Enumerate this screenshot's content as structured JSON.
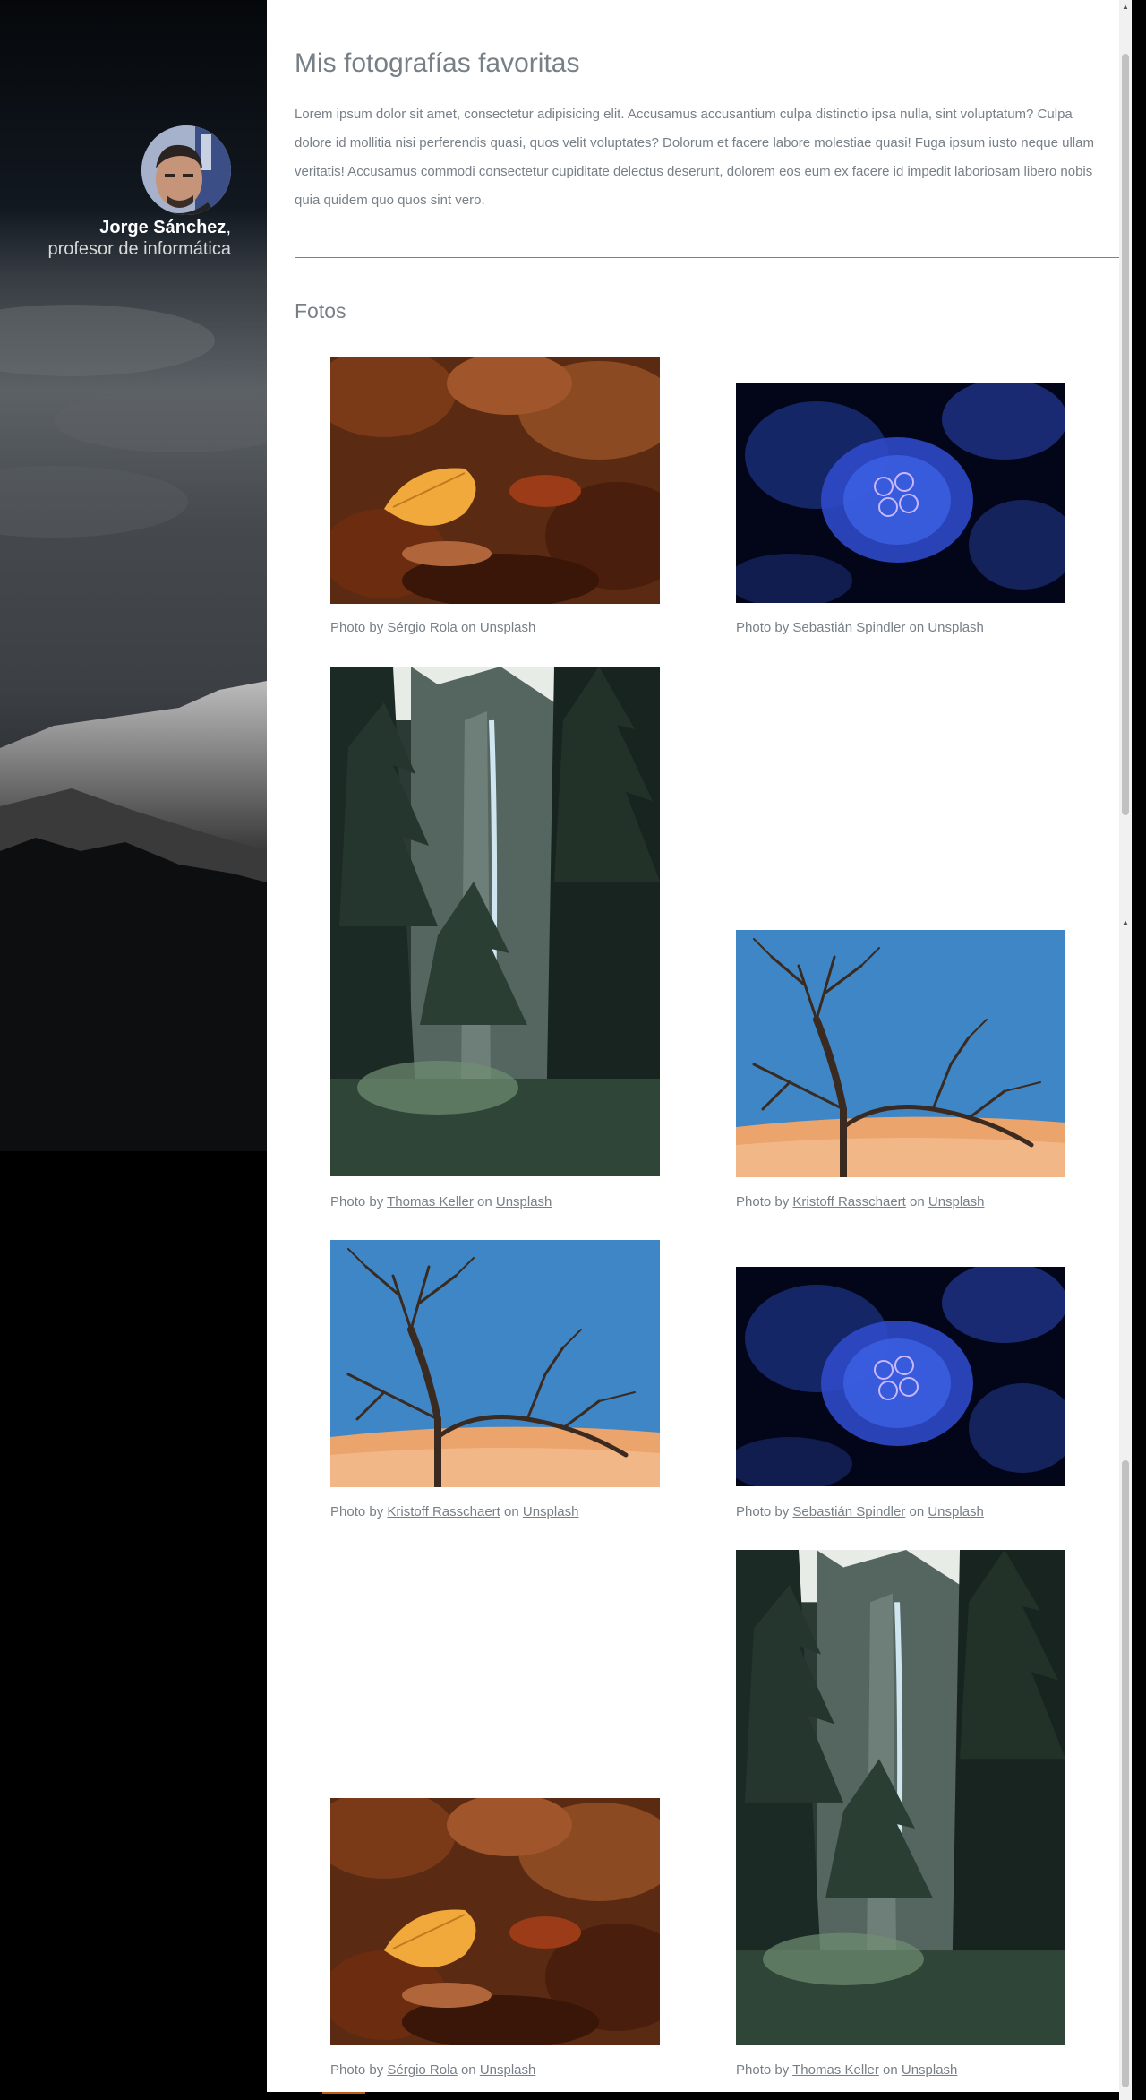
{
  "sidebar": {
    "name": "Jorge Sánchez",
    "name_suffix": ",",
    "role": "profesor de informática"
  },
  "main": {
    "title": "Mis fotografías favoritas",
    "intro": "Lorem ipsum dolor sit amet, consectetur adipisicing elit. Accusamus accusantium culpa distinctio ipsa nulla, sint voluptatum? Culpa dolore id mollitia nisi perferendis quasi, quos velit voluptates? Dolorum et facere labore molestiae quasi! Fuga ipsum iusto neque ullam veritatis! Accusamus commodi consectetur cupiditate delectus deserunt, dolorem eos eum ex facere id impedit laboriosam libero nobis quia quidem quo quos sint vero.",
    "section_title": "Fotos",
    "caption_prefix": "Photo by",
    "caption_on": "on",
    "caption_site": "Unsplash",
    "photos": [
      {
        "photographer": "Sérgio Rola",
        "subject": "autumn-leaves"
      },
      {
        "photographer": "Sebastián Spindler",
        "subject": "jellyfish"
      },
      {
        "photographer": "Thomas Keller",
        "subject": "waterfall-forest"
      },
      {
        "photographer": "Kristoff Rasschaert",
        "subject": "dead-tree-desert"
      },
      {
        "photographer": "Kristoff Rasschaert",
        "subject": "dead-tree-desert"
      },
      {
        "photographer": "Sebastián Spindler",
        "subject": "jellyfish"
      },
      {
        "photographer": "Sérgio Rola",
        "subject": "autumn-leaves"
      },
      {
        "photographer": "Thomas Keller",
        "subject": "waterfall-forest"
      }
    ]
  },
  "colors": {
    "text": "#777f87",
    "background": "#ffffff",
    "sidebar": "#000000",
    "rule": "#7a8288"
  }
}
